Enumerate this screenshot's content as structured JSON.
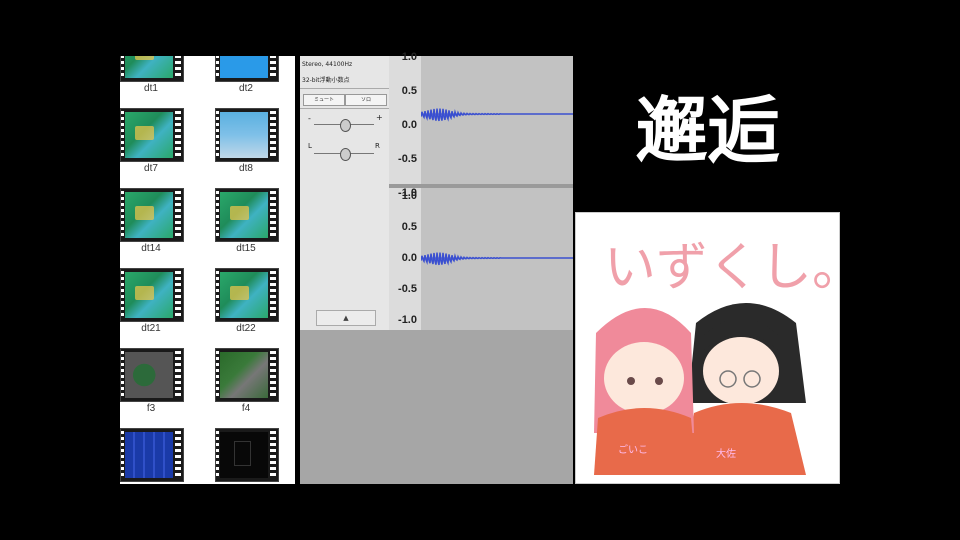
{
  "explorer": {
    "items": [
      {
        "label": "dt1",
        "style": "g"
      },
      {
        "label": "dt2",
        "style": "blue"
      },
      {
        "label": "dt7",
        "style": "g"
      },
      {
        "label": "dt8",
        "style": "sky"
      },
      {
        "label": "dt14",
        "style": "g"
      },
      {
        "label": "dt15",
        "style": "g"
      },
      {
        "label": "dt21",
        "style": "g"
      },
      {
        "label": "dt22",
        "style": "g"
      },
      {
        "label": "f3",
        "style": "dark1"
      },
      {
        "label": "f4",
        "style": "dark2"
      },
      {
        "label": "",
        "style": "navy"
      },
      {
        "label": "",
        "style": "black"
      }
    ]
  },
  "audacity": {
    "track_info": "Stereo, 44100Hz",
    "track_format": "32-bit浮動小数点",
    "mute_label": "ミュート",
    "solo_label": "ソロ",
    "gain_minus": "-",
    "gain_plus": "+",
    "pan_left": "L",
    "pan_right": "R",
    "collapse_glyph": "▲",
    "ruler_ticks": [
      "1.0",
      "0.5",
      "0.0",
      "-0.5",
      "-1.0"
    ],
    "ruler_ticks_2": [
      "1.0",
      "0.5",
      "0.0",
      "-0.5",
      "-1.0"
    ],
    "wave_color": "#3a4fd0"
  },
  "title": {
    "text": "邂逅"
  },
  "artwork": {
    "caption": "いずくし。",
    "shirt_left": "ごいこ",
    "shirt_right": "大佐",
    "hair_pink": "#f08a9a",
    "hair_dark": "#2a2a2a",
    "sweater": "#e86a4a"
  }
}
